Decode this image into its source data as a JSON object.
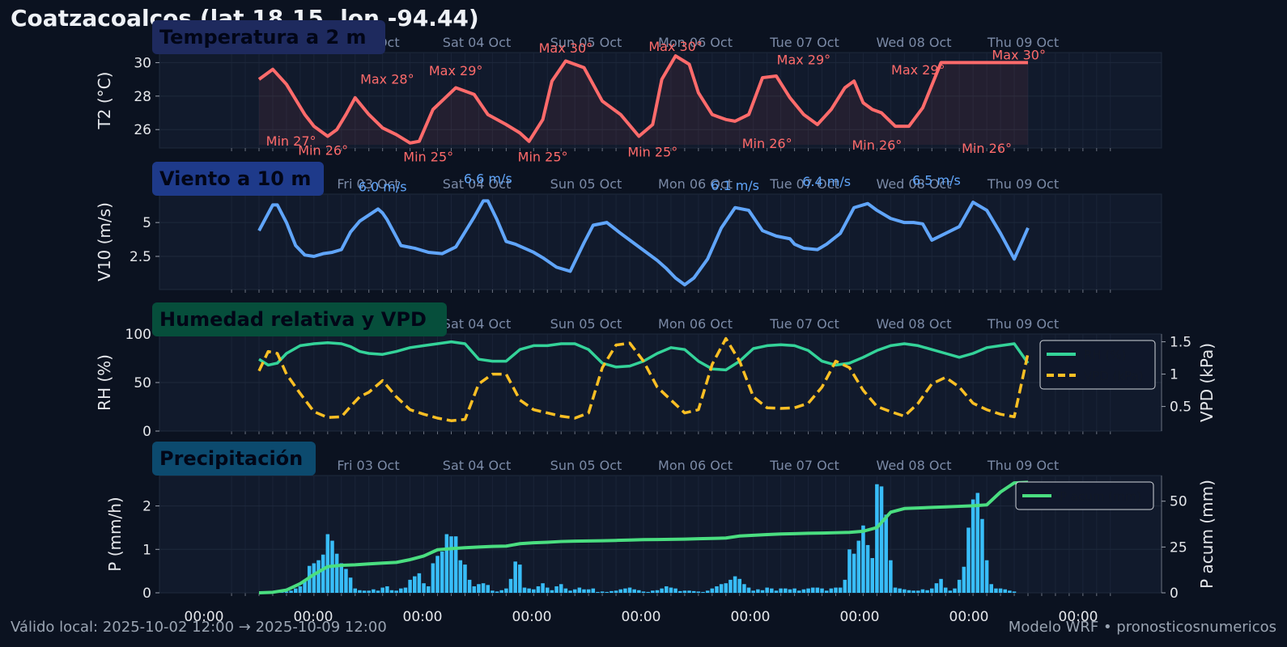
{
  "header": {
    "title": "Coatzacoalcos (lat 18.15, lon -94.44)"
  },
  "footer": {
    "valid": "Válido local: 2025-10-02 12:00 → 2025-10-09 12:00",
    "credit": "Modelo WRF • pronosticosnumericos"
  },
  "colors": {
    "background": "#0b1220",
    "panel": "#111a2c",
    "temperature": "#ff6b6b",
    "wind": "#60a5fa",
    "rh": "#34d399",
    "vpd": "#fbbf24",
    "precip_bars": "#38bdf8",
    "precip_accum": "#4ade80"
  },
  "chart_data": [
    {
      "id": "temperature",
      "type": "line",
      "badge": "Temperatura a 2 m",
      "badge_color": "#1e2a5e",
      "ylabel": "T2 (°C)",
      "ylim": [
        24.9,
        30.6
      ],
      "yticks": [
        26,
        28,
        30
      ],
      "date_labels": [
        "Fri 03 Oct",
        "Sat 04 Oct",
        "Sun 05 Oct",
        "Mon 06 Oct",
        "Tue 07 Oct",
        "Wed 08 Oct",
        "Thu 09 Oct"
      ],
      "x_hours": [
        0,
        3,
        6,
        8,
        10,
        12,
        14,
        15,
        17,
        19,
        21,
        24,
        27,
        30,
        33,
        35,
        38,
        43,
        47,
        50,
        54,
        57,
        59,
        62,
        64,
        67,
        71,
        75,
        79,
        83,
        86,
        88,
        91,
        94,
        96,
        99,
        102,
        104,
        107,
        110,
        113,
        116,
        119,
        122,
        125,
        128,
        130,
        132,
        134,
        136,
        139,
        142,
        145,
        149,
        152,
        154,
        156,
        159,
        162,
        165,
        168
      ],
      "series": [
        {
          "name": "",
          "color": "#ff6b6b",
          "values": [
            29.0,
            29.6,
            28.7,
            27.8,
            26.9,
            26.2,
            25.8,
            25.6,
            26.0,
            26.9,
            27.9,
            26.9,
            26.1,
            25.7,
            25.2,
            25.3,
            27.2,
            28.5,
            28.1,
            26.9,
            26.3,
            25.8,
            25.3,
            26.6,
            28.9,
            30.1,
            29.7,
            27.7,
            26.9,
            25.6,
            26.3,
            29.0,
            30.4,
            29.9,
            28.2,
            26.9,
            26.6,
            26.5,
            26.9,
            29.1,
            29.2,
            27.9,
            26.9,
            26.3,
            27.2,
            28.5,
            28.9,
            27.6,
            27.2,
            27.0,
            26.2,
            26.2,
            27.3,
            30.0,
            30.0,
            30.0,
            30.0,
            30.0,
            30.0,
            30.0,
            30.0
          ]
        }
      ],
      "annotations": [
        {
          "text": "Min 27°",
          "h": 7,
          "y": 25.05,
          "kind": "min"
        },
        {
          "text": "Min 26°",
          "h": 14,
          "y": 24.5,
          "kind": "min"
        },
        {
          "text": "Max 28°",
          "h": 28,
          "y": 28.75,
          "kind": "max"
        },
        {
          "text": "Min 25°",
          "h": 37,
          "y": 24.1,
          "kind": "min"
        },
        {
          "text": "Max 29°",
          "h": 43,
          "y": 29.25,
          "kind": "max"
        },
        {
          "text": "Min 25°",
          "h": 62,
          "y": 24.1,
          "kind": "min"
        },
        {
          "text": "Max 30°",
          "h": 67,
          "y": 30.6,
          "kind": "max"
        },
        {
          "text": "Min 25°",
          "h": 86,
          "y": 24.4,
          "kind": "min"
        },
        {
          "text": "Max 30°",
          "h": 91,
          "y": 30.7,
          "kind": "max"
        },
        {
          "text": "Min 26°",
          "h": 111,
          "y": 24.9,
          "kind": "min"
        },
        {
          "text": "Max 29°",
          "h": 119,
          "y": 29.9,
          "kind": "max"
        },
        {
          "text": "Min 26°",
          "h": 135,
          "y": 24.8,
          "kind": "min"
        },
        {
          "text": "Max 29°",
          "h": 144,
          "y": 29.3,
          "kind": "max"
        },
        {
          "text": "Min 26°",
          "h": 159,
          "y": 24.6,
          "kind": "min"
        },
        {
          "text": "Max 30°",
          "h": 166,
          "y": 30.2,
          "kind": "max"
        }
      ]
    },
    {
      "id": "wind",
      "type": "line",
      "badge": "Viento a 10 m",
      "badge_color": "#1e3a8a",
      "ylabel": "V10 (m/s)",
      "ylim": [
        0.05,
        7.1
      ],
      "yticks": [
        2.5,
        5.0
      ],
      "date_labels": [
        "Fri 03 Oct",
        "Sat 04 Oct",
        "Sun 05 Oct",
        "Mon 06 Oct",
        "Tue 07 Oct",
        "Wed 08 Oct",
        "Thu 09 Oct"
      ],
      "x_hours": [
        0,
        3,
        4,
        6,
        8,
        10,
        12,
        14,
        16,
        18,
        20,
        22,
        26,
        27,
        28,
        31,
        34,
        37,
        40,
        43,
        47,
        49,
        50,
        52,
        54,
        56,
        58,
        60,
        62,
        65,
        68,
        71,
        73,
        76,
        79,
        83,
        87,
        89,
        91,
        93,
        95,
        98,
        101,
        104,
        107,
        110,
        113,
        116,
        117,
        119,
        122,
        124,
        127,
        130,
        133,
        135,
        138,
        141,
        143,
        145,
        147,
        150,
        153,
        156,
        159,
        162,
        165,
        168
      ],
      "series": [
        {
          "name": "",
          "color": "#60a5fa",
          "values": [
            4.4,
            6.3,
            6.3,
            5.0,
            3.3,
            2.6,
            2.5,
            2.7,
            2.8,
            3.0,
            4.3,
            5.1,
            6.0,
            5.7,
            5.2,
            3.3,
            3.1,
            2.8,
            2.7,
            3.2,
            5.4,
            6.6,
            6.6,
            5.2,
            3.6,
            3.4,
            3.1,
            2.8,
            2.4,
            1.7,
            1.4,
            3.5,
            4.8,
            5.0,
            4.2,
            3.2,
            2.2,
            1.6,
            0.9,
            0.4,
            0.9,
            2.3,
            4.6,
            6.1,
            5.9,
            4.4,
            4.0,
            3.8,
            3.4,
            3.1,
            3.0,
            3.4,
            4.2,
            6.1,
            6.4,
            5.9,
            5.3,
            5.0,
            5.0,
            4.9,
            3.7,
            4.2,
            4.7,
            6.5,
            5.9,
            4.2,
            2.3,
            4.6
          ]
        }
      ],
      "annotations": [
        {
          "text": "6.0 m/s",
          "h": 27,
          "y": 7.3,
          "kind": "max"
        },
        {
          "text": "6.6 m/s",
          "h": 50,
          "y": 7.9,
          "kind": "max"
        },
        {
          "text": "6.1 m/s",
          "h": 104,
          "y": 7.4,
          "kind": "max"
        },
        {
          "text": "6.4 m/s",
          "h": 124,
          "y": 7.7,
          "kind": "max"
        },
        {
          "text": "6.5 m/s",
          "h": 148,
          "y": 7.8,
          "kind": "max"
        }
      ]
    },
    {
      "id": "humidity",
      "type": "line",
      "badge": "Humedad relativa y VPD",
      "badge_color": "#064e3b",
      "ylabel": "RH (%)",
      "ylabel2": "VPD (kPa)",
      "ylim": [
        0,
        100
      ],
      "yticks": [
        0,
        50,
        100
      ],
      "ylim2": [
        0.12,
        1.62
      ],
      "yticks2": [
        0.5,
        1.0,
        1.5
      ],
      "date_labels": [
        "Fri 03 Oct",
        "Sat 04 Oct",
        "Sun 05 Oct",
        "Mon 06 Oct",
        "Tue 07 Oct",
        "Wed 08 Oct",
        "Thu 09 Oct"
      ],
      "x_hours": [
        0,
        2,
        4,
        6,
        9,
        12,
        15,
        18,
        20,
        22,
        24,
        27,
        30,
        33,
        36,
        39,
        42,
        45,
        48,
        51,
        54,
        57,
        60,
        63,
        66,
        69,
        72,
        75,
        78,
        81,
        84,
        87,
        90,
        93,
        96,
        99,
        102,
        105,
        108,
        111,
        114,
        117,
        120,
        123,
        126,
        129,
        132,
        135,
        138,
        141,
        144,
        147,
        150,
        153,
        156,
        159,
        162,
        165,
        168
      ],
      "series": [
        {
          "name": "RH (%)",
          "color": "#34d399",
          "axis": "left",
          "values": [
            74,
            68,
            70,
            80,
            88,
            90,
            91,
            90,
            87,
            82,
            80,
            79,
            82,
            86,
            88,
            90,
            92,
            90,
            74,
            72,
            72,
            84,
            88,
            88,
            90,
            90,
            84,
            70,
            66,
            67,
            72,
            80,
            86,
            84,
            72,
            64,
            63,
            72,
            85,
            88,
            89,
            88,
            83,
            72,
            68,
            70,
            76,
            83,
            88,
            90,
            88,
            84,
            80,
            76,
            80,
            86,
            88,
            90,
            70
          ]
        },
        {
          "name": "VPD (kPa)",
          "color": "#fbbf24",
          "axis": "right",
          "dashed": true,
          "values": [
            1.05,
            1.35,
            1.32,
            1.0,
            0.7,
            0.42,
            0.33,
            0.34,
            0.5,
            0.65,
            0.72,
            0.9,
            0.65,
            0.45,
            0.38,
            0.32,
            0.28,
            0.3,
            0.85,
            1.0,
            1.0,
            0.6,
            0.45,
            0.4,
            0.35,
            0.32,
            0.4,
            1.1,
            1.45,
            1.48,
            1.2,
            0.8,
            0.6,
            0.4,
            0.45,
            1.15,
            1.55,
            1.2,
            0.65,
            0.48,
            0.47,
            0.48,
            0.55,
            0.8,
            1.2,
            1.1,
            0.75,
            0.5,
            0.42,
            0.35,
            0.55,
            0.85,
            0.95,
            0.8,
            0.55,
            0.45,
            0.38,
            0.34,
            1.32
          ]
        }
      ],
      "legend": "top-right"
    },
    {
      "id": "precipitation",
      "type": "bar",
      "badge": "Precipitación",
      "badge_color": "#0c4a6e",
      "ylabel": "P (mm/h)",
      "ylabel2": "P acum (mm)",
      "ylim": [
        0,
        2.7
      ],
      "yticks": [
        0,
        1,
        2
      ],
      "ylim2": [
        0,
        64
      ],
      "yticks2": [
        0,
        25,
        50
      ],
      "date_labels": [
        "Fri 03 Oct",
        "Sat 04 Oct",
        "Sun 05 Oct",
        "Mon 06 Oct",
        "Tue 07 Oct",
        "Wed 08 Oct",
        "Thu 09 Oct"
      ],
      "bottom_ticks": [
        "00:00",
        "00:00",
        "00:00",
        "00:00",
        "00:00",
        "00:00",
        "00:00",
        "00:00",
        "00:00"
      ],
      "x_hours": [
        0,
        3,
        6,
        9,
        12,
        15,
        18,
        21,
        24,
        27,
        30,
        33,
        36,
        39,
        42,
        45,
        48,
        51,
        54,
        57,
        60,
        63,
        66,
        69,
        72,
        75,
        78,
        81,
        84,
        87,
        90,
        93,
        96,
        99,
        102,
        105,
        108,
        111,
        114,
        117,
        120,
        123,
        126,
        129,
        132,
        135,
        138,
        141,
        144,
        147,
        150,
        153,
        156,
        159,
        162,
        165,
        168
      ],
      "series": [
        {
          "name": "P acum (mm)",
          "color": "#4ade80",
          "axis": "right",
          "kind": "line",
          "values": [
            0,
            0.3,
            1.5,
            5,
            10,
            14.3,
            15,
            15.3,
            15.8,
            16.2,
            16.6,
            18.1,
            20.1,
            23.5,
            24.1,
            24.6,
            25,
            25.3,
            25.5,
            26.8,
            27.3,
            27.6,
            28,
            28.2,
            28.3,
            28.4,
            28.6,
            28.8,
            29,
            29.1,
            29.2,
            29.3,
            29.5,
            29.7,
            29.9,
            31,
            31.4,
            31.8,
            32.1,
            32.3,
            32.5,
            32.6,
            32.8,
            33,
            33.6,
            35.6,
            44,
            46,
            46.3,
            46.6,
            46.9,
            47.2,
            47.5,
            48,
            55,
            60,
            60.3
          ]
        },
        {
          "name": "",
          "color": "#38bdf8",
          "axis": "left",
          "kind": "bar",
          "start_hour": 0,
          "values": [
            0,
            0,
            0,
            0,
            0,
            0.02,
            0.03,
            0.05,
            0.1,
            0.15,
            0.3,
            0.62,
            0.68,
            0.75,
            0.88,
            1.35,
            1.2,
            0.9,
            0.68,
            0.55,
            0.35,
            0.1,
            0.06,
            0.05,
            0.05,
            0.08,
            0.05,
            0.12,
            0.15,
            0.06,
            0.05,
            0.1,
            0.12,
            0.3,
            0.38,
            0.45,
            0.22,
            0.15,
            0.68,
            0.85,
            0.95,
            1.35,
            1.3,
            1.3,
            0.75,
            0.65,
            0.3,
            0.15,
            0.2,
            0.22,
            0.18,
            0.05,
            0.03,
            0.06,
            0.1,
            0.32,
            0.72,
            0.65,
            0.12,
            0.1,
            0.08,
            0.15,
            0.22,
            0.12,
            0.06,
            0.15,
            0.2,
            0.1,
            0.05,
            0.08,
            0.12,
            0.08,
            0.08,
            0.1,
            0.02,
            0.03,
            0.02,
            0.04,
            0.05,
            0.08,
            0.1,
            0.12,
            0.08,
            0.06,
            0.03,
            0.02,
            0.05,
            0.06,
            0.1,
            0.15,
            0.12,
            0.1,
            0.04,
            0.05,
            0.05,
            0.04,
            0.03,
            0.02,
            0.05,
            0.1,
            0.15,
            0.2,
            0.22,
            0.3,
            0.38,
            0.32,
            0.2,
            0.12,
            0.05,
            0.08,
            0.06,
            0.12,
            0.1,
            0.05,
            0.1,
            0.1,
            0.08,
            0.1,
            0.05,
            0.08,
            0.1,
            0.12,
            0.12,
            0.1,
            0.05,
            0.1,
            0.12,
            0.12,
            0.3,
            1.0,
            0.9,
            1.2,
            1.55,
            1.1,
            0.8,
            2.5,
            2.45,
            1.8,
            0.75,
            0.12,
            0.1,
            0.08,
            0.06,
            0.05,
            0.05,
            0.08,
            0.06,
            0.1,
            0.22,
            0.32,
            0.12,
            0.05,
            0.1,
            0.3,
            0.6,
            1.5,
            2.15,
            2.3,
            1.7,
            0.75,
            0.2,
            0.1,
            0.1,
            0.08,
            0.05,
            0.03
          ]
        }
      ],
      "legend": "top-right"
    }
  ]
}
